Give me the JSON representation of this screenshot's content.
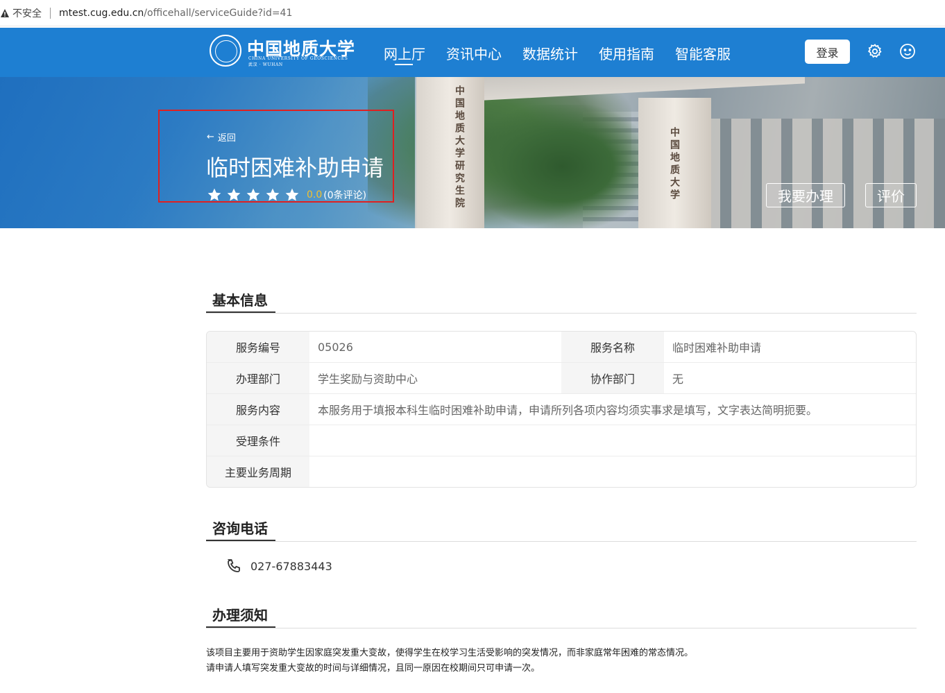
{
  "browser": {
    "insecure_label": "不安全",
    "url_host": "mtest.cug.edu.cn",
    "url_path": "/officehall/serviceGuide?id=41"
  },
  "header": {
    "logo_name": "中国地质大学",
    "logo_en": "CHINA UNIVERSITY OF GEOSCIENCES",
    "logo_sub": "武汉 · WUHAN",
    "nav": [
      "网上厅",
      "资讯中心",
      "数据统计",
      "使用指南",
      "智能客服"
    ],
    "active_nav": "网上厅",
    "login_label": "登录",
    "settings_icon": "gear-icon",
    "service_icon": "smiley-icon",
    "color": "#1e7fd2"
  },
  "banner": {
    "back_label": "返回",
    "title": "临时困难补助申请",
    "stars": 5,
    "score": "0.0",
    "review_count": "(0条评论)",
    "handle_button": "我要办理",
    "rate_button": "评价",
    "pillar_left_text": "中国地质大学研究生院",
    "pillar_right_text": "中国地质大学"
  },
  "basic_info": {
    "title": "基本信息",
    "rows": [
      {
        "label1": "服务编号",
        "value1": "05026",
        "label2": "服务名称",
        "value2": "临时困难补助申请"
      },
      {
        "label1": "办理部门",
        "value1": "学生奖励与资助中心",
        "label2": "协作部门",
        "value2": "无"
      },
      {
        "label1": "服务内容",
        "value1": "本服务用于填报本科生临时困难补助申请，申请所列各项内容均须实事求是填写，文字表达简明扼要。"
      },
      {
        "label1": "受理条件",
        "value1": ""
      },
      {
        "label1": "主要业务周期",
        "value1": ""
      }
    ]
  },
  "contact": {
    "title": "咨询电话",
    "phone": "027-67883443"
  },
  "notice": {
    "title": "办理须知",
    "lines": [
      "该项目主要用于资助学生因家庭突发重大变故，使得学生在校学习生活受影响的突发情况，而非家庭常年困难的常态情况。",
      "请申请人填写突发重大变故的时间与详细情况，且同一原因在校期间只可申请一次。"
    ]
  }
}
